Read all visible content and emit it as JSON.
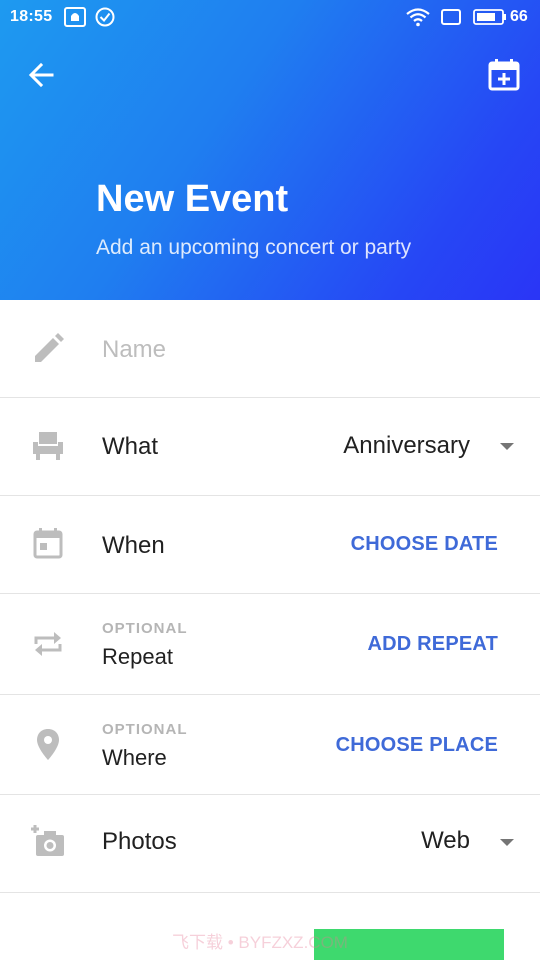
{
  "status_bar": {
    "time": "18:55",
    "battery": "66",
    "icons": [
      "notification-icon",
      "check-circle-icon",
      "wifi-icon",
      "screen-icon",
      "battery-icon"
    ]
  },
  "header": {
    "title": "New Event",
    "subtitle": "Add an upcoming concert or party",
    "back_icon": "arrow-left-icon",
    "add_calendar_icon": "calendar-plus-icon",
    "gradient_start": "#1e9af0",
    "gradient_end": "#2a35f6"
  },
  "form": {
    "name": {
      "placeholder": "Name",
      "icon": "pencil-icon"
    },
    "what": {
      "label": "What",
      "value": "Anniversary",
      "icon": "seat-icon"
    },
    "when": {
      "label": "When",
      "action": "CHOOSE DATE",
      "icon": "calendar-icon"
    },
    "repeat": {
      "optional": "OPTIONAL",
      "label": "Repeat",
      "action": "ADD REPEAT",
      "icon": "repeat-icon"
    },
    "where": {
      "optional": "OPTIONAL",
      "label": "Where",
      "action": "CHOOSE PLACE",
      "icon": "location-pin-icon"
    },
    "photos": {
      "label": "Photos",
      "value": "Web",
      "icon": "add-photo-icon"
    }
  },
  "colors": {
    "accent": "#3f6ad8",
    "icon_gray": "#bdbdbd",
    "divider": "#e4e4e4"
  },
  "watermark": "飞下载 • BYFZXZ.COM"
}
